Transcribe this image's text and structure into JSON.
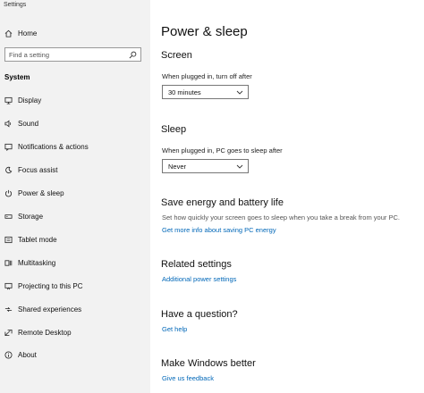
{
  "window": {
    "title": "Settings"
  },
  "sidebar": {
    "home": {
      "label": "Home",
      "icon": "home-icon"
    },
    "search": {
      "placeholder": "Find a setting",
      "icon": "search-icon"
    },
    "section": "System",
    "items": [
      {
        "label": "Display",
        "icon": "display-icon"
      },
      {
        "label": "Sound",
        "icon": "sound-icon"
      },
      {
        "label": "Notifications & actions",
        "icon": "notifications-icon"
      },
      {
        "label": "Focus assist",
        "icon": "focus-assist-icon"
      },
      {
        "label": "Power & sleep",
        "icon": "power-icon"
      },
      {
        "label": "Storage",
        "icon": "storage-icon"
      },
      {
        "label": "Tablet mode",
        "icon": "tablet-icon"
      },
      {
        "label": "Multitasking",
        "icon": "multitasking-icon"
      },
      {
        "label": "Projecting to this PC",
        "icon": "projecting-icon"
      },
      {
        "label": "Shared experiences",
        "icon": "shared-experiences-icon"
      },
      {
        "label": "Remote Desktop",
        "icon": "remote-desktop-icon"
      },
      {
        "label": "About",
        "icon": "info-icon"
      }
    ]
  },
  "main": {
    "title": "Power & sleep",
    "screen": {
      "heading": "Screen",
      "label": "When plugged in, turn off after",
      "value": "30 minutes"
    },
    "sleep": {
      "heading": "Sleep",
      "label": "When plugged in, PC goes to sleep after",
      "value": "Never"
    },
    "save_energy": {
      "heading": "Save energy and battery life",
      "description": "Set how quickly your screen goes to sleep when you take a break from your PC.",
      "link": "Get more info about saving PC energy"
    },
    "related": {
      "heading": "Related settings",
      "link": "Additional power settings"
    },
    "question": {
      "heading": "Have a question?",
      "link": "Get help"
    },
    "better": {
      "heading": "Make Windows better",
      "link": "Give us feedback"
    }
  }
}
